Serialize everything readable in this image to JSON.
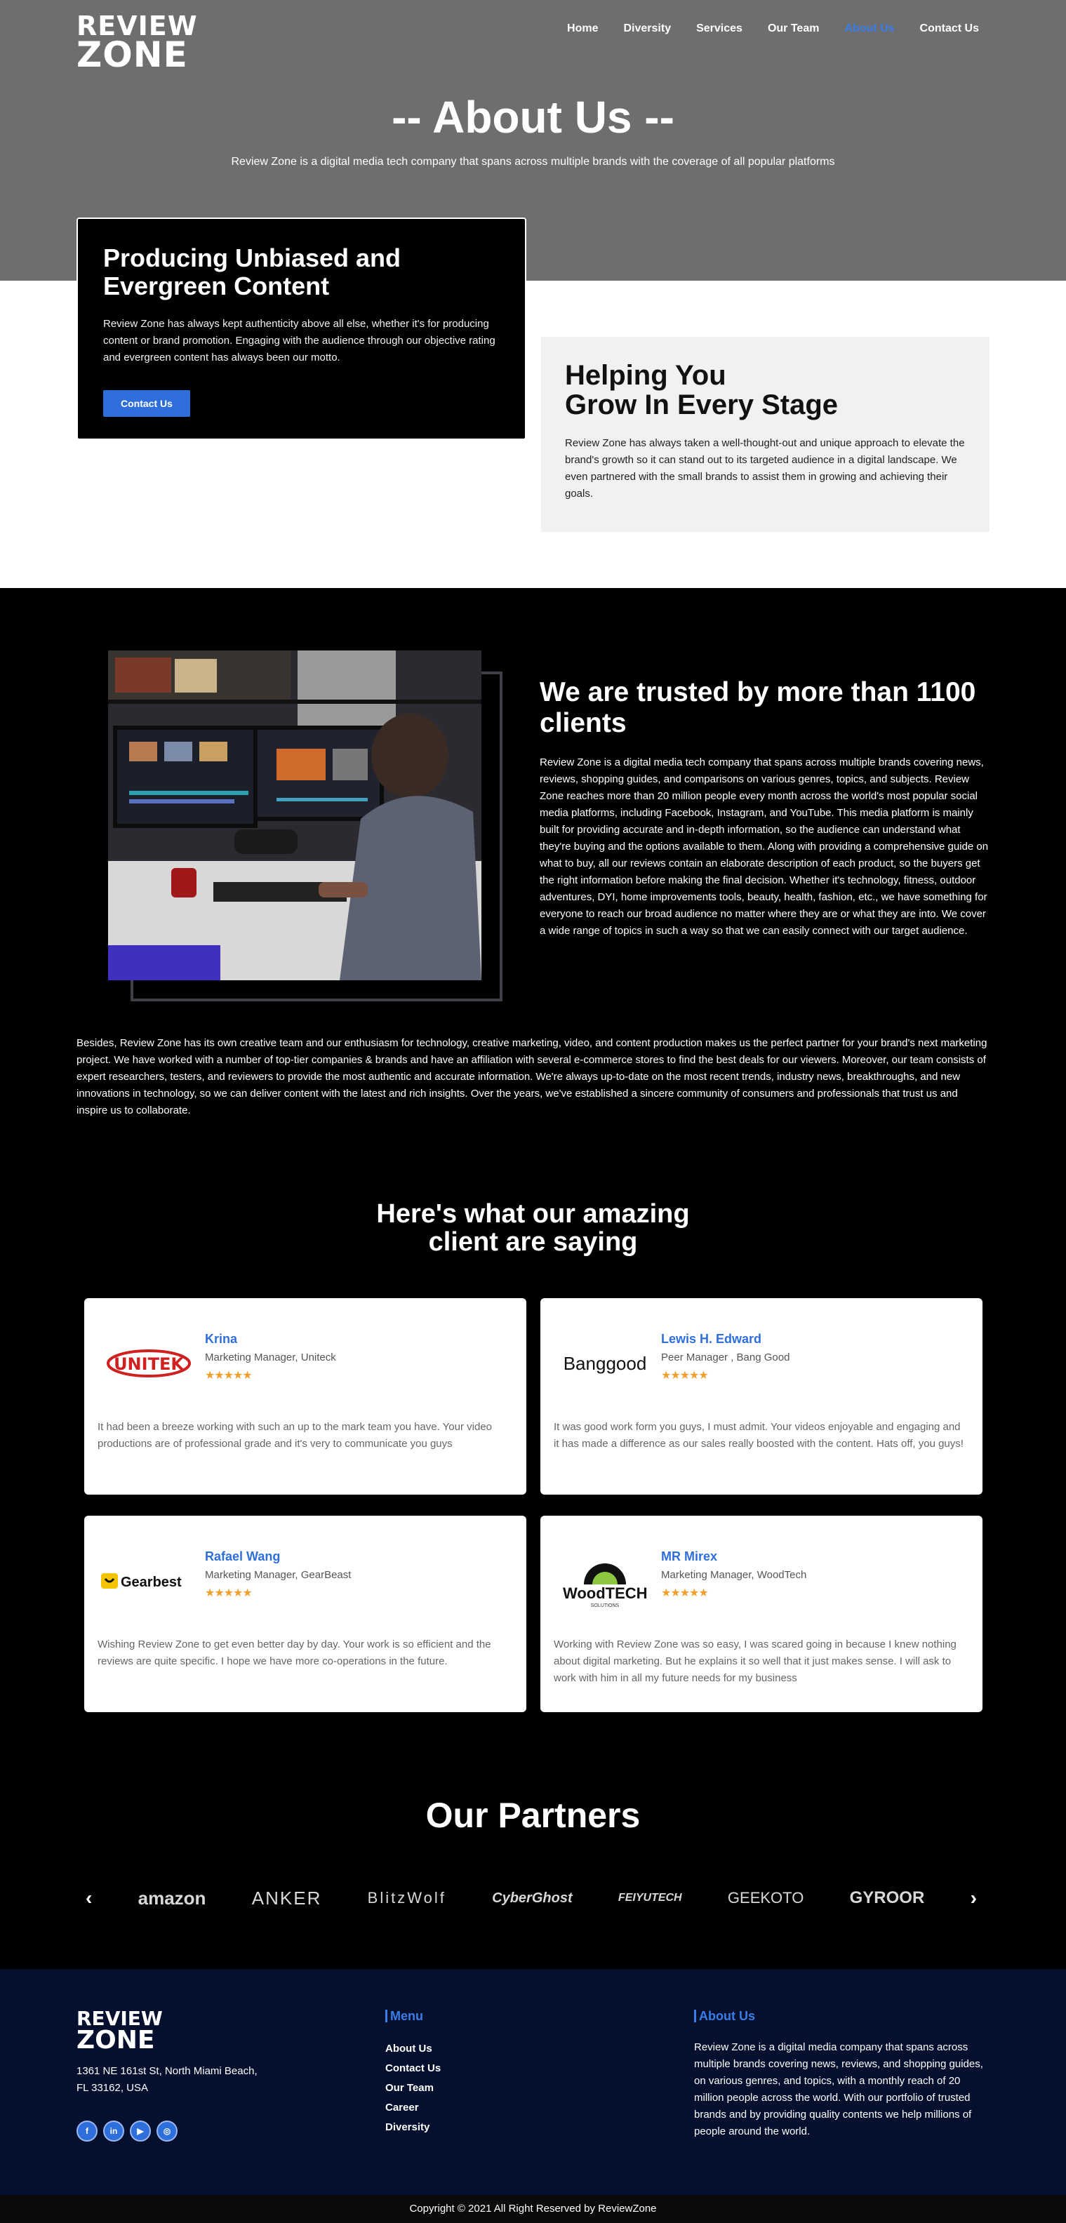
{
  "brand": {
    "logo_line1": "REVIEW",
    "logo_line2": "ZONE"
  },
  "nav": {
    "items": [
      "Home",
      "Diversity",
      "Services",
      "Our Team",
      "About Us",
      "Contact Us"
    ],
    "active": "About Us"
  },
  "hero": {
    "title": "-- About Us --",
    "subtitle": "Review Zone is a digital media tech company that spans across multiple brands with the coverage of all popular platforms"
  },
  "producing": {
    "title": "Producing Unbiased and Evergreen Content",
    "text": "Review Zone has always kept authenticity above all else, whether it's for producing content or brand promotion. Engaging with the audience through our objective rating and evergreen content has always been our motto.",
    "button": "Contact Us"
  },
  "helping": {
    "title_line1": "Helping You",
    "title_line2": "Grow In Every Stage",
    "text": "Review Zone has always taken a well-thought-out and unique approach to elevate the brand's growth so it can stand out to its targeted audience in a digital landscape. We even partnered with the small brands to assist them in growing and achieving their goals."
  },
  "trusted": {
    "title": "We are trusted by more than 1100 clients",
    "text": "Review Zone is a digital media tech company that spans across multiple brands covering news, reviews, shopping guides, and comparisons on various genres, topics, and subjects. Review Zone reaches more than 20 million people every month across the world's most popular social media platforms, including Facebook, Instagram, and YouTube. This media platform is mainly built for providing accurate and in-depth information, so the audience can understand what they're buying and the options available to them. Along with providing a comprehensive guide on what to buy, all our reviews contain an elaborate description of each product, so the buyers get the right information before making the final decision. Whether it's technology, fitness, outdoor adventures, DYI, home improvements tools, beauty, health, fashion, etc., we have something for everyone to reach our broad audience no matter where they are or what they are into. We cover a wide range of topics in such a way so that we can easily connect with our target audience."
  },
  "besides": "Besides, Review Zone has its own creative team and our enthusiasm for technology, creative marketing, video, and content production makes us the perfect partner for your brand's next marketing project. We have worked with a number of top-tier companies & brands and have an affiliation with several e-commerce stores to find the best deals for our viewers. Moreover, our team consists of expert researchers, testers, and reviewers to provide the most authentic and accurate information. We're always up-to-date on the most recent trends, industry news, breakthroughs, and new innovations in technology, so we can deliver content with the latest and rich insights. Over the years,  we've established a sincere community of consumers and professionals that trust us and inspire us to collaborate.",
  "testimonials": {
    "title_line1": "Here's what our amazing",
    "title_line2": "client are saying",
    "items": [
      {
        "name": "Krina",
        "role": "Marketing Manager, Uniteck",
        "logo": "UNITEK",
        "stars": 5,
        "quote": "It had been a breeze working with such an up to the mark team you have. Your video productions are of professional grade and it's very to communicate you guys"
      },
      {
        "name": "Lewis H. Edward",
        "role": "Peer Manager , Bang Good",
        "logo": "Banggood",
        "stars": 5,
        "quote": "It was good work form you guys, I must admit. Your videos enjoyable and engaging and it has made a difference as our sales really boosted with the content. Hats off, you guys!"
      },
      {
        "name": "Rafael Wang",
        "role": "Marketing Manager, GearBeast",
        "logo": "Gearbest",
        "stars": 5,
        "quote": "Wishing Review Zone to get even better day by day. Your work is so efficient and the reviews are quite specific. I hope we have more co-operations in the future."
      },
      {
        "name": "MR Mirex",
        "role": "Marketing Manager, WoodTech",
        "logo": "WoodTECH",
        "logo_sub": "SOLUTIONS",
        "stars": 5,
        "quote": "Working with Review Zone was so easy, I was scared going in because I knew nothing about digital marketing. But he explains it so well that it just makes sense. I will ask to work with him in all my future needs for my business"
      }
    ]
  },
  "partners": {
    "title": "Our Partners",
    "logos": [
      "amazon",
      "ANKER",
      "BlitzWolf",
      "CyberGhost",
      "FEIYUTECH",
      "GEEKOTO",
      "GYROOR"
    ]
  },
  "footer": {
    "address_line1": "1361 NE 161st St, North Miami Beach,",
    "address_line2": "FL 33162, USA",
    "social": [
      "facebook-icon",
      "linkedin-icon",
      "youtube-icon",
      "instagram-icon"
    ],
    "menu_title": "Menu",
    "menu": [
      "About Us",
      "Contact Us",
      "Our Team",
      "Career",
      "Diversity"
    ],
    "about_title": "About Us",
    "about_text": "Review Zone is a digital media company that spans across multiple brands covering news, reviews, and shopping guides, on various genres, and topics, with a monthly reach of 20 million people across the world. With our portfolio of trusted brands and by providing quality contents we help millions of people around the world.",
    "copyright": "Copyright © 2021 All Right Reserved by ReviewZone"
  },
  "colors": {
    "accent": "#2f6fdc",
    "hero_bg": "#6e6e6e",
    "footer_bg": "#05102e",
    "stars": "#f0a030"
  }
}
